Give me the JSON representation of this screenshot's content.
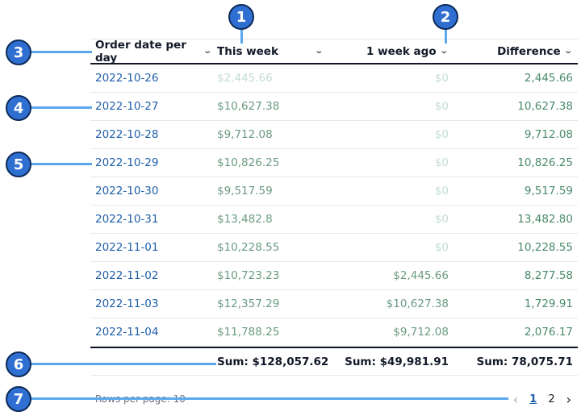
{
  "table": {
    "columns": [
      {
        "label": "Order date per day"
      },
      {
        "label": "This week"
      },
      {
        "label": "1 week ago"
      },
      {
        "label": "Difference"
      }
    ],
    "rows": [
      {
        "date": "2022-10-26",
        "this_week": "$2,445.66",
        "week_ago": "$0",
        "difference": "2,445.66"
      },
      {
        "date": "2022-10-27",
        "this_week": "$10,627.38",
        "week_ago": "$0",
        "difference": "10,627.38"
      },
      {
        "date": "2022-10-28",
        "this_week": "$9,712.08",
        "week_ago": "$0",
        "difference": "9,712.08"
      },
      {
        "date": "2022-10-29",
        "this_week": "$10,826.25",
        "week_ago": "$0",
        "difference": "10,826.25"
      },
      {
        "date": "2022-10-30",
        "this_week": "$9,517.59",
        "week_ago": "$0",
        "difference": "9,517.59"
      },
      {
        "date": "2022-10-31",
        "this_week": "$13,482.8",
        "week_ago": "$0",
        "difference": "13,482.80"
      },
      {
        "date": "2022-11-01",
        "this_week": "$10,228.55",
        "week_ago": "$0",
        "difference": "10,228.55"
      },
      {
        "date": "2022-11-02",
        "this_week": "$10,723.23",
        "week_ago": "$2,445.66",
        "difference": "8,277.58"
      },
      {
        "date": "2022-11-03",
        "this_week": "$12,357.29",
        "week_ago": "$10,627.38",
        "difference": "1,729.91"
      },
      {
        "date": "2022-11-04",
        "this_week": "$11,788.25",
        "week_ago": "$9,712.08",
        "difference": "2,076.17"
      }
    ],
    "sums": {
      "this_week": "Sum: $128,057.62",
      "week_ago": "Sum: $49,981.91",
      "difference": "Sum: 78,075.71"
    }
  },
  "footer": {
    "rows_per_page": "Rows per page: 10",
    "pages": [
      "1",
      "2"
    ],
    "current_page": "1"
  },
  "callouts": [
    "1",
    "2",
    "3",
    "4",
    "5",
    "6",
    "7"
  ],
  "colors": {
    "badge": "#2f6fd1",
    "callout_line": "#5aa9ee",
    "date_link": "#1f5fa8",
    "value_green": "#4a8a6a"
  }
}
